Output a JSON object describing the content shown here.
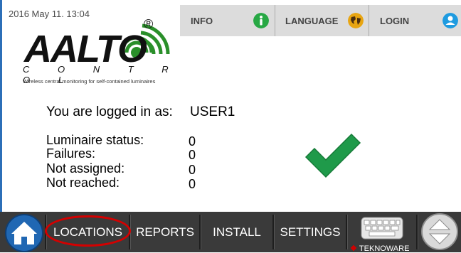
{
  "header": {
    "datetime": "2016 May 11. 13:04"
  },
  "logo": {
    "brand": "AALTO",
    "subtitle": "C O N T R O L",
    "registered": "®",
    "tagline": "Wireless central monitoring for self-contained luminaires"
  },
  "topbar": {
    "info_label": "INFO",
    "language_label": "LANGUAGE",
    "login_label": "LOGIN",
    "info_icon": "info-icon",
    "language_icon": "globe-icon",
    "login_icon": "user-icon"
  },
  "main": {
    "logged_in_label": "You are logged in as:",
    "logged_in_user": "USER1",
    "status": [
      {
        "label": "Luminaire status:",
        "value": "0"
      },
      {
        "label": "Failures:",
        "value": "0"
      },
      {
        "label": "Not assigned:",
        "value": "0"
      },
      {
        "label": "Not reached:",
        "value": "0"
      }
    ],
    "status_icon": "checkmark-icon"
  },
  "nav": {
    "home_icon": "home-icon",
    "items": [
      "LOCATIONS",
      "REPORTS",
      "INSTALL",
      "SETTINGS"
    ],
    "keyboard_icon": "keyboard-icon",
    "scroll_icon": "scroll-updown-icon",
    "footer_brand": "TEKNOWARE"
  },
  "colors": {
    "accent_blue": "#1f5fa8",
    "info_green": "#27a844",
    "check_green": "#1f9a4a",
    "highlight_red": "#d40000",
    "bottom_bar": "#3a3a3a",
    "top_bar": "#dcdcdc"
  }
}
